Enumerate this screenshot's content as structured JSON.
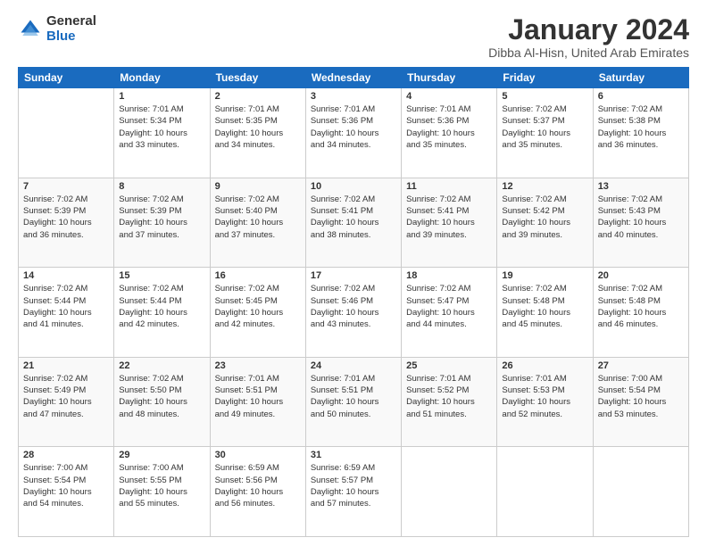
{
  "header": {
    "logo_general": "General",
    "logo_blue": "Blue",
    "month_title": "January 2024",
    "location": "Dibba Al-Hisn, United Arab Emirates"
  },
  "calendar": {
    "days_of_week": [
      "Sunday",
      "Monday",
      "Tuesday",
      "Wednesday",
      "Thursday",
      "Friday",
      "Saturday"
    ],
    "weeks": [
      [
        {
          "day": "",
          "info": ""
        },
        {
          "day": "1",
          "info": "Sunrise: 7:01 AM\nSunset: 5:34 PM\nDaylight: 10 hours\nand 33 minutes."
        },
        {
          "day": "2",
          "info": "Sunrise: 7:01 AM\nSunset: 5:35 PM\nDaylight: 10 hours\nand 34 minutes."
        },
        {
          "day": "3",
          "info": "Sunrise: 7:01 AM\nSunset: 5:36 PM\nDaylight: 10 hours\nand 34 minutes."
        },
        {
          "day": "4",
          "info": "Sunrise: 7:01 AM\nSunset: 5:36 PM\nDaylight: 10 hours\nand 35 minutes."
        },
        {
          "day": "5",
          "info": "Sunrise: 7:02 AM\nSunset: 5:37 PM\nDaylight: 10 hours\nand 35 minutes."
        },
        {
          "day": "6",
          "info": "Sunrise: 7:02 AM\nSunset: 5:38 PM\nDaylight: 10 hours\nand 36 minutes."
        }
      ],
      [
        {
          "day": "7",
          "info": "Sunrise: 7:02 AM\nSunset: 5:39 PM\nDaylight: 10 hours\nand 36 minutes."
        },
        {
          "day": "8",
          "info": "Sunrise: 7:02 AM\nSunset: 5:39 PM\nDaylight: 10 hours\nand 37 minutes."
        },
        {
          "day": "9",
          "info": "Sunrise: 7:02 AM\nSunset: 5:40 PM\nDaylight: 10 hours\nand 37 minutes."
        },
        {
          "day": "10",
          "info": "Sunrise: 7:02 AM\nSunset: 5:41 PM\nDaylight: 10 hours\nand 38 minutes."
        },
        {
          "day": "11",
          "info": "Sunrise: 7:02 AM\nSunset: 5:41 PM\nDaylight: 10 hours\nand 39 minutes."
        },
        {
          "day": "12",
          "info": "Sunrise: 7:02 AM\nSunset: 5:42 PM\nDaylight: 10 hours\nand 39 minutes."
        },
        {
          "day": "13",
          "info": "Sunrise: 7:02 AM\nSunset: 5:43 PM\nDaylight: 10 hours\nand 40 minutes."
        }
      ],
      [
        {
          "day": "14",
          "info": "Sunrise: 7:02 AM\nSunset: 5:44 PM\nDaylight: 10 hours\nand 41 minutes."
        },
        {
          "day": "15",
          "info": "Sunrise: 7:02 AM\nSunset: 5:44 PM\nDaylight: 10 hours\nand 42 minutes."
        },
        {
          "day": "16",
          "info": "Sunrise: 7:02 AM\nSunset: 5:45 PM\nDaylight: 10 hours\nand 42 minutes."
        },
        {
          "day": "17",
          "info": "Sunrise: 7:02 AM\nSunset: 5:46 PM\nDaylight: 10 hours\nand 43 minutes."
        },
        {
          "day": "18",
          "info": "Sunrise: 7:02 AM\nSunset: 5:47 PM\nDaylight: 10 hours\nand 44 minutes."
        },
        {
          "day": "19",
          "info": "Sunrise: 7:02 AM\nSunset: 5:48 PM\nDaylight: 10 hours\nand 45 minutes."
        },
        {
          "day": "20",
          "info": "Sunrise: 7:02 AM\nSunset: 5:48 PM\nDaylight: 10 hours\nand 46 minutes."
        }
      ],
      [
        {
          "day": "21",
          "info": "Sunrise: 7:02 AM\nSunset: 5:49 PM\nDaylight: 10 hours\nand 47 minutes."
        },
        {
          "day": "22",
          "info": "Sunrise: 7:02 AM\nSunset: 5:50 PM\nDaylight: 10 hours\nand 48 minutes."
        },
        {
          "day": "23",
          "info": "Sunrise: 7:01 AM\nSunset: 5:51 PM\nDaylight: 10 hours\nand 49 minutes."
        },
        {
          "day": "24",
          "info": "Sunrise: 7:01 AM\nSunset: 5:51 PM\nDaylight: 10 hours\nand 50 minutes."
        },
        {
          "day": "25",
          "info": "Sunrise: 7:01 AM\nSunset: 5:52 PM\nDaylight: 10 hours\nand 51 minutes."
        },
        {
          "day": "26",
          "info": "Sunrise: 7:01 AM\nSunset: 5:53 PM\nDaylight: 10 hours\nand 52 minutes."
        },
        {
          "day": "27",
          "info": "Sunrise: 7:00 AM\nSunset: 5:54 PM\nDaylight: 10 hours\nand 53 minutes."
        }
      ],
      [
        {
          "day": "28",
          "info": "Sunrise: 7:00 AM\nSunset: 5:54 PM\nDaylight: 10 hours\nand 54 minutes."
        },
        {
          "day": "29",
          "info": "Sunrise: 7:00 AM\nSunset: 5:55 PM\nDaylight: 10 hours\nand 55 minutes."
        },
        {
          "day": "30",
          "info": "Sunrise: 6:59 AM\nSunset: 5:56 PM\nDaylight: 10 hours\nand 56 minutes."
        },
        {
          "day": "31",
          "info": "Sunrise: 6:59 AM\nSunset: 5:57 PM\nDaylight: 10 hours\nand 57 minutes."
        },
        {
          "day": "",
          "info": ""
        },
        {
          "day": "",
          "info": ""
        },
        {
          "day": "",
          "info": ""
        }
      ]
    ]
  }
}
